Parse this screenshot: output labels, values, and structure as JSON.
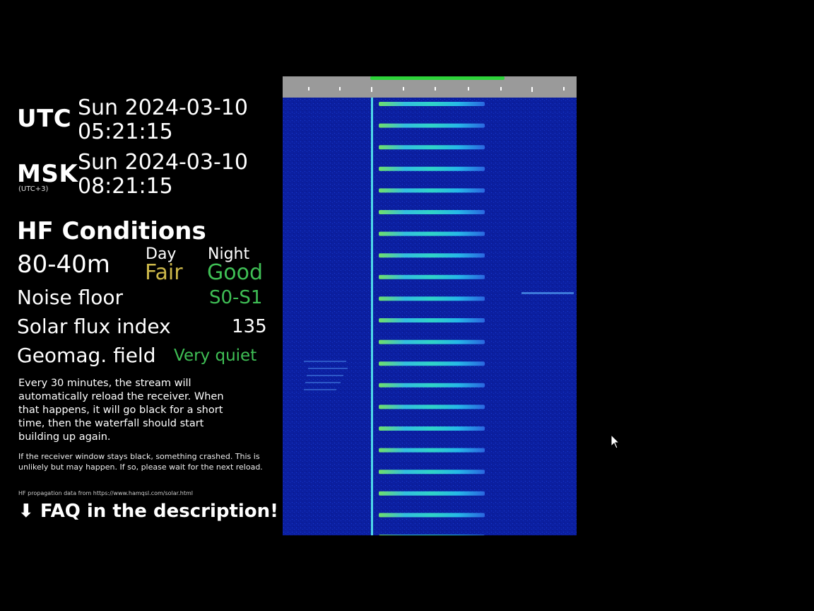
{
  "clocks": {
    "utc": {
      "label": "UTC",
      "date": "Sun 2024-03-10",
      "time": "05:21:15"
    },
    "msk": {
      "label": "MSK",
      "sublabel": "(UTC+3)",
      "date": "Sun 2024-03-10",
      "time": "08:21:15"
    }
  },
  "conditions": {
    "title": "HF Conditions",
    "band": "80-40m",
    "day_label": "Day",
    "night_label": "Night",
    "day_value": "Fair",
    "night_value": "Good",
    "noise_label": "Noise floor",
    "noise_value": "S0-S1",
    "sfi_label": "Solar flux index",
    "sfi_value": "135",
    "geomag_label": "Geomag. field",
    "geomag_value": "Very quiet"
  },
  "notes": {
    "reload": "Every 30 minutes, the stream will automatically reload the receiver. When that happens, it will go black for a short time, then the waterfall should start building up again.",
    "crash": "If the receiver window stays black, something crashed. This is unlikely but may happen. If so, please wait for the next reload.",
    "source": "HF propagation data from https://www.hamqsl.com/solar.html",
    "faq": "⬇ FAQ in the description! ⬇"
  },
  "colors": {
    "fair": "#cdb84a",
    "good": "#3fbf55",
    "waterfall_bg": "#0a1e9a",
    "scale_bg": "#9a9a9a",
    "passband": "#2ed33a",
    "marker": "#4fd8e8"
  },
  "icons": {
    "cursor": "mouse-pointer-icon"
  }
}
